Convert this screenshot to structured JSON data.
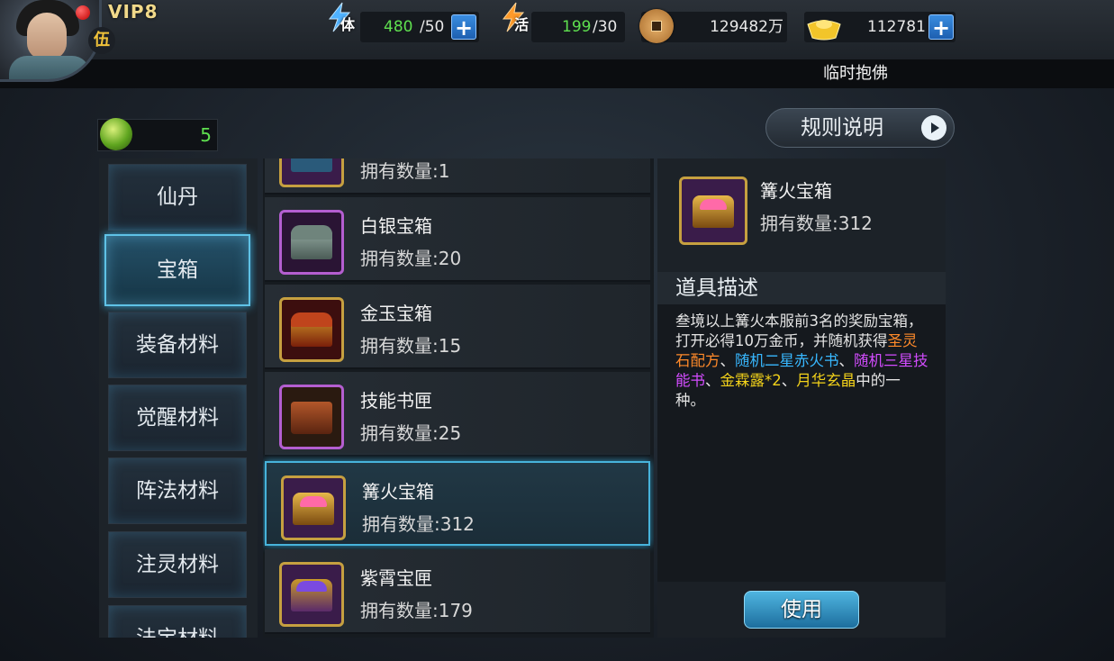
{
  "player": {
    "vip_label": "VIP8",
    "rank_glyph": "伍",
    "name": "临时抱佛"
  },
  "resources": {
    "stamina": {
      "icon": "stamina-bolt-icon",
      "glyph": "体",
      "current": "480",
      "max": "/50"
    },
    "vitality": {
      "icon": "vitality-bolt-icon",
      "glyph": "活",
      "current": "199",
      "max": "/30"
    },
    "coins": {
      "icon": "copper-coin-icon",
      "value": "129482万"
    },
    "ingots": {
      "icon": "gold-ingot-icon",
      "value": "112781"
    },
    "plus_glyph": "+"
  },
  "jade": {
    "icon": "jade-icon",
    "value": "5"
  },
  "rules_button": "规则说明",
  "categories": [
    {
      "label": "仙丹"
    },
    {
      "label": "宝箱"
    },
    {
      "label": "装备材料"
    },
    {
      "label": "觉醒材料"
    },
    {
      "label": "阵法材料"
    },
    {
      "label": "注灵材料"
    },
    {
      "label": "法宝材料"
    }
  ],
  "items": [
    {
      "name": "",
      "count": "拥有数量:1"
    },
    {
      "name": "白银宝箱",
      "count": "拥有数量:20"
    },
    {
      "name": "金玉宝箱",
      "count": "拥有数量:15"
    },
    {
      "name": "技能书匣",
      "count": "拥有数量:25"
    },
    {
      "name": "篝火宝箱",
      "count": "拥有数量:312"
    },
    {
      "name": "紫霄宝匣",
      "count": "拥有数量:179"
    }
  ],
  "detail": {
    "name": "篝火宝箱",
    "count": "拥有数量:312",
    "desc_title": "道具描述",
    "desc_parts": [
      "叁境以上篝火本服前3名的奖励宝箱，打开必得10万金币，并随机获得",
      "圣灵石配方",
      "、",
      "随机二星赤火书",
      "、",
      "随机三星技能书",
      "、",
      "金霖露*2",
      "、",
      "月华玄晶",
      "中的一种。"
    ],
    "use_button": "使用"
  },
  "colors": {
    "highlight_cyan": "#47b3db",
    "green_value": "#5fe04f",
    "orange": "#ff8a2a",
    "cyan": "#38b8ff",
    "purple": "#d34cff",
    "yellow": "#f3d21a"
  }
}
